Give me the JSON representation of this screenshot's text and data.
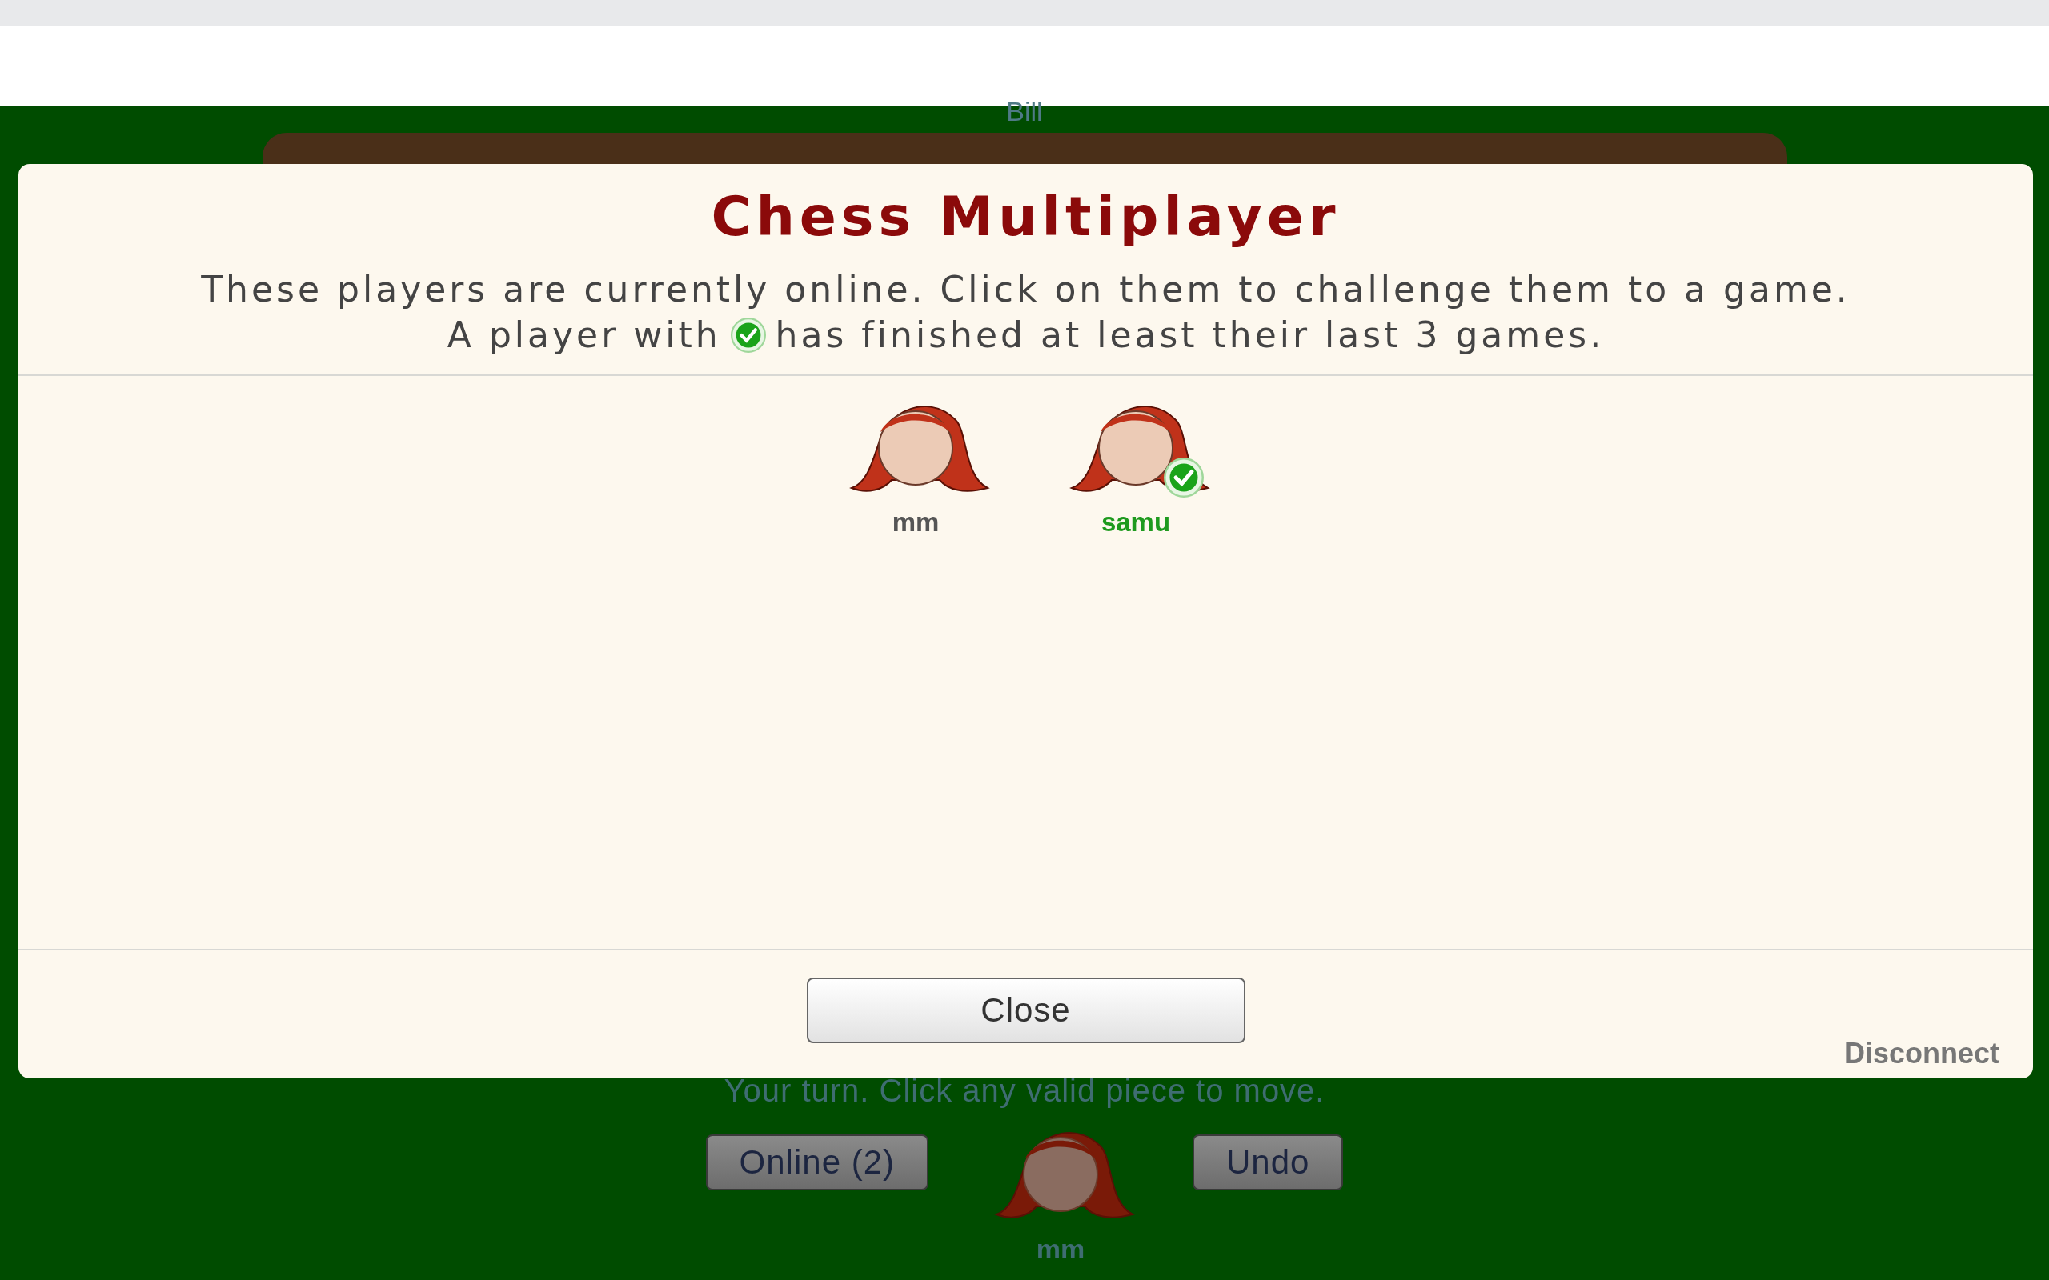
{
  "opponent": {
    "name": "Bill"
  },
  "dialog": {
    "title": "Chess Multiplayer",
    "intro": "These players are currently online. Click on them to challenge them to a game.",
    "note_before": "A player with",
    "note_after": "has finished at least their last 3 games.",
    "players": [
      {
        "name": "mm",
        "verified": false
      },
      {
        "name": "samu",
        "verified": true
      }
    ],
    "close_button": "Close",
    "disconnect_link": "Disconnect"
  },
  "status": "Your turn. Click any valid piece to move.",
  "controls": {
    "online_button": "Online (2)",
    "undo_button": "Undo",
    "player_name": "mm"
  }
}
